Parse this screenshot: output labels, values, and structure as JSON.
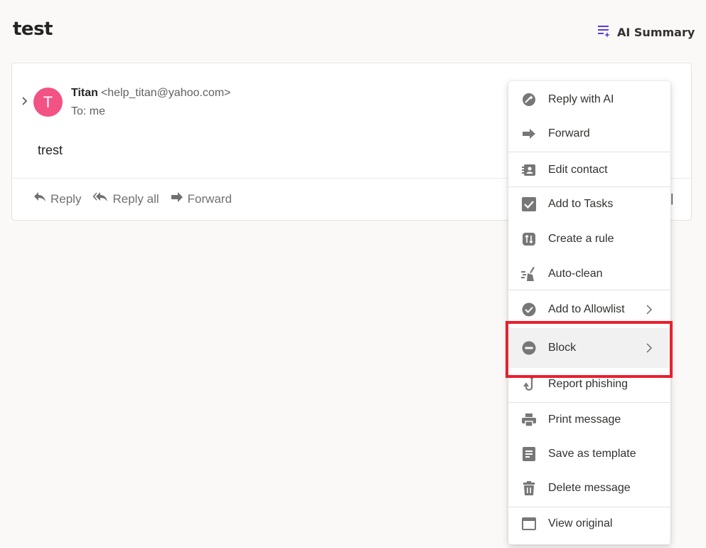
{
  "email": {
    "subject": "test",
    "ai_summary_label": "AI Summary",
    "sender": {
      "avatar_letter": "T",
      "name": "Titan",
      "email": "<help_titan@yahoo.com>",
      "to": "To: me"
    },
    "body": "trest",
    "actions": {
      "reply": "Reply",
      "reply_all": "Reply all",
      "forward": "Forward"
    }
  },
  "context_menu": {
    "items": [
      {
        "label": "Reply with AI",
        "icon": "reply-with-ai-icon"
      },
      {
        "label": "Forward",
        "icon": "forward-arrow-icon"
      },
      {
        "label": "Edit contact",
        "icon": "contact-card-icon"
      },
      {
        "label": "Add to Tasks",
        "icon": "checkbox-icon"
      },
      {
        "label": "Create a rule",
        "icon": "rule-icon"
      },
      {
        "label": "Auto-clean",
        "icon": "broom-icon"
      },
      {
        "label": "Add to Allowlist",
        "icon": "check-circle-icon",
        "submenu": true
      },
      {
        "label": "Block",
        "icon": "block-icon",
        "submenu": true,
        "highlighted": true
      },
      {
        "label": "Report phishing",
        "icon": "fishhook-icon"
      },
      {
        "label": "Print message",
        "icon": "printer-icon"
      },
      {
        "label": "Save as template",
        "icon": "template-icon"
      },
      {
        "label": "Delete message",
        "icon": "trash-icon"
      },
      {
        "label": "View original",
        "icon": "window-icon"
      }
    ]
  },
  "colors": {
    "avatar": "#f35285",
    "ai_accent": "#5b3fd6",
    "highlight_outline": "#e8212e",
    "icon_gray": "#777777"
  }
}
